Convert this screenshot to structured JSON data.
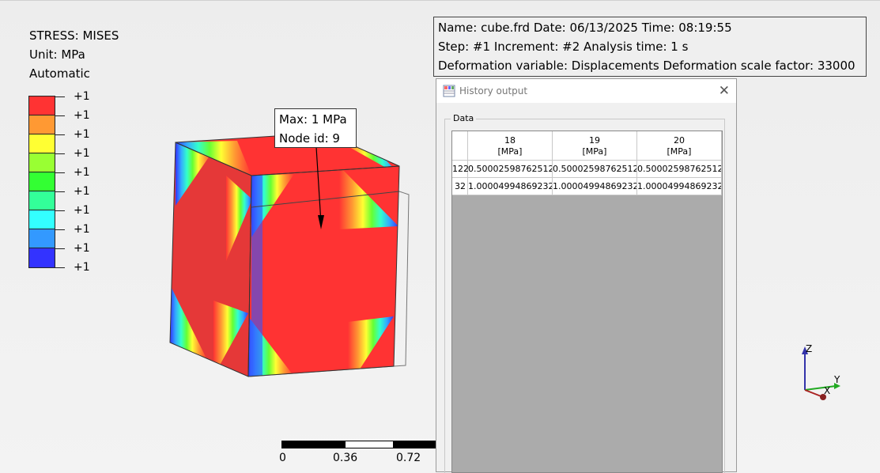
{
  "legend": {
    "title": "STRESS: MISES",
    "unit": "Unit: MPa",
    "mode": "Automatic",
    "labels": [
      "+1",
      "+1",
      "+1",
      "+1",
      "+1",
      "+1",
      "+1",
      "+1",
      "+1",
      "+1"
    ],
    "colors": [
      "#ff3333",
      "#ff9933",
      "#ffff33",
      "#99ff33",
      "#33ff33",
      "#33ff99",
      "#33ffff",
      "#3399ff",
      "#3333ff"
    ]
  },
  "info": {
    "line1": "Name: cube.frd   Date: 06/13/2025   Time: 08:19:55",
    "line2": "Step: #1   Increment: #2   Analysis time: 1 s",
    "line3": "Deformation variable: Displacements   Deformation scale factor: 33000"
  },
  "callout": {
    "max": "Max: 1 MPa",
    "node": "Node id: 9"
  },
  "scale": {
    "labels": [
      "0",
      "0.36",
      "0.72"
    ]
  },
  "axes": {
    "z": "Z",
    "y": "Y",
    "x": "X"
  },
  "dialog": {
    "title": "History output",
    "group_label": "Data",
    "columns": [
      {
        "id": "18",
        "unit": "[MPa]"
      },
      {
        "id": "19",
        "unit": "[MPa]"
      },
      {
        "id": "20",
        "unit": "[MPa]"
      }
    ],
    "row_headers": [
      "122",
      "32"
    ],
    "rows": [
      [
        "0.500025987625122",
        "0.500025987625122",
        "0.500025987625122"
      ],
      [
        "1.00004994869232",
        "1.00004994869232",
        "1.00004994869232"
      ]
    ]
  }
}
